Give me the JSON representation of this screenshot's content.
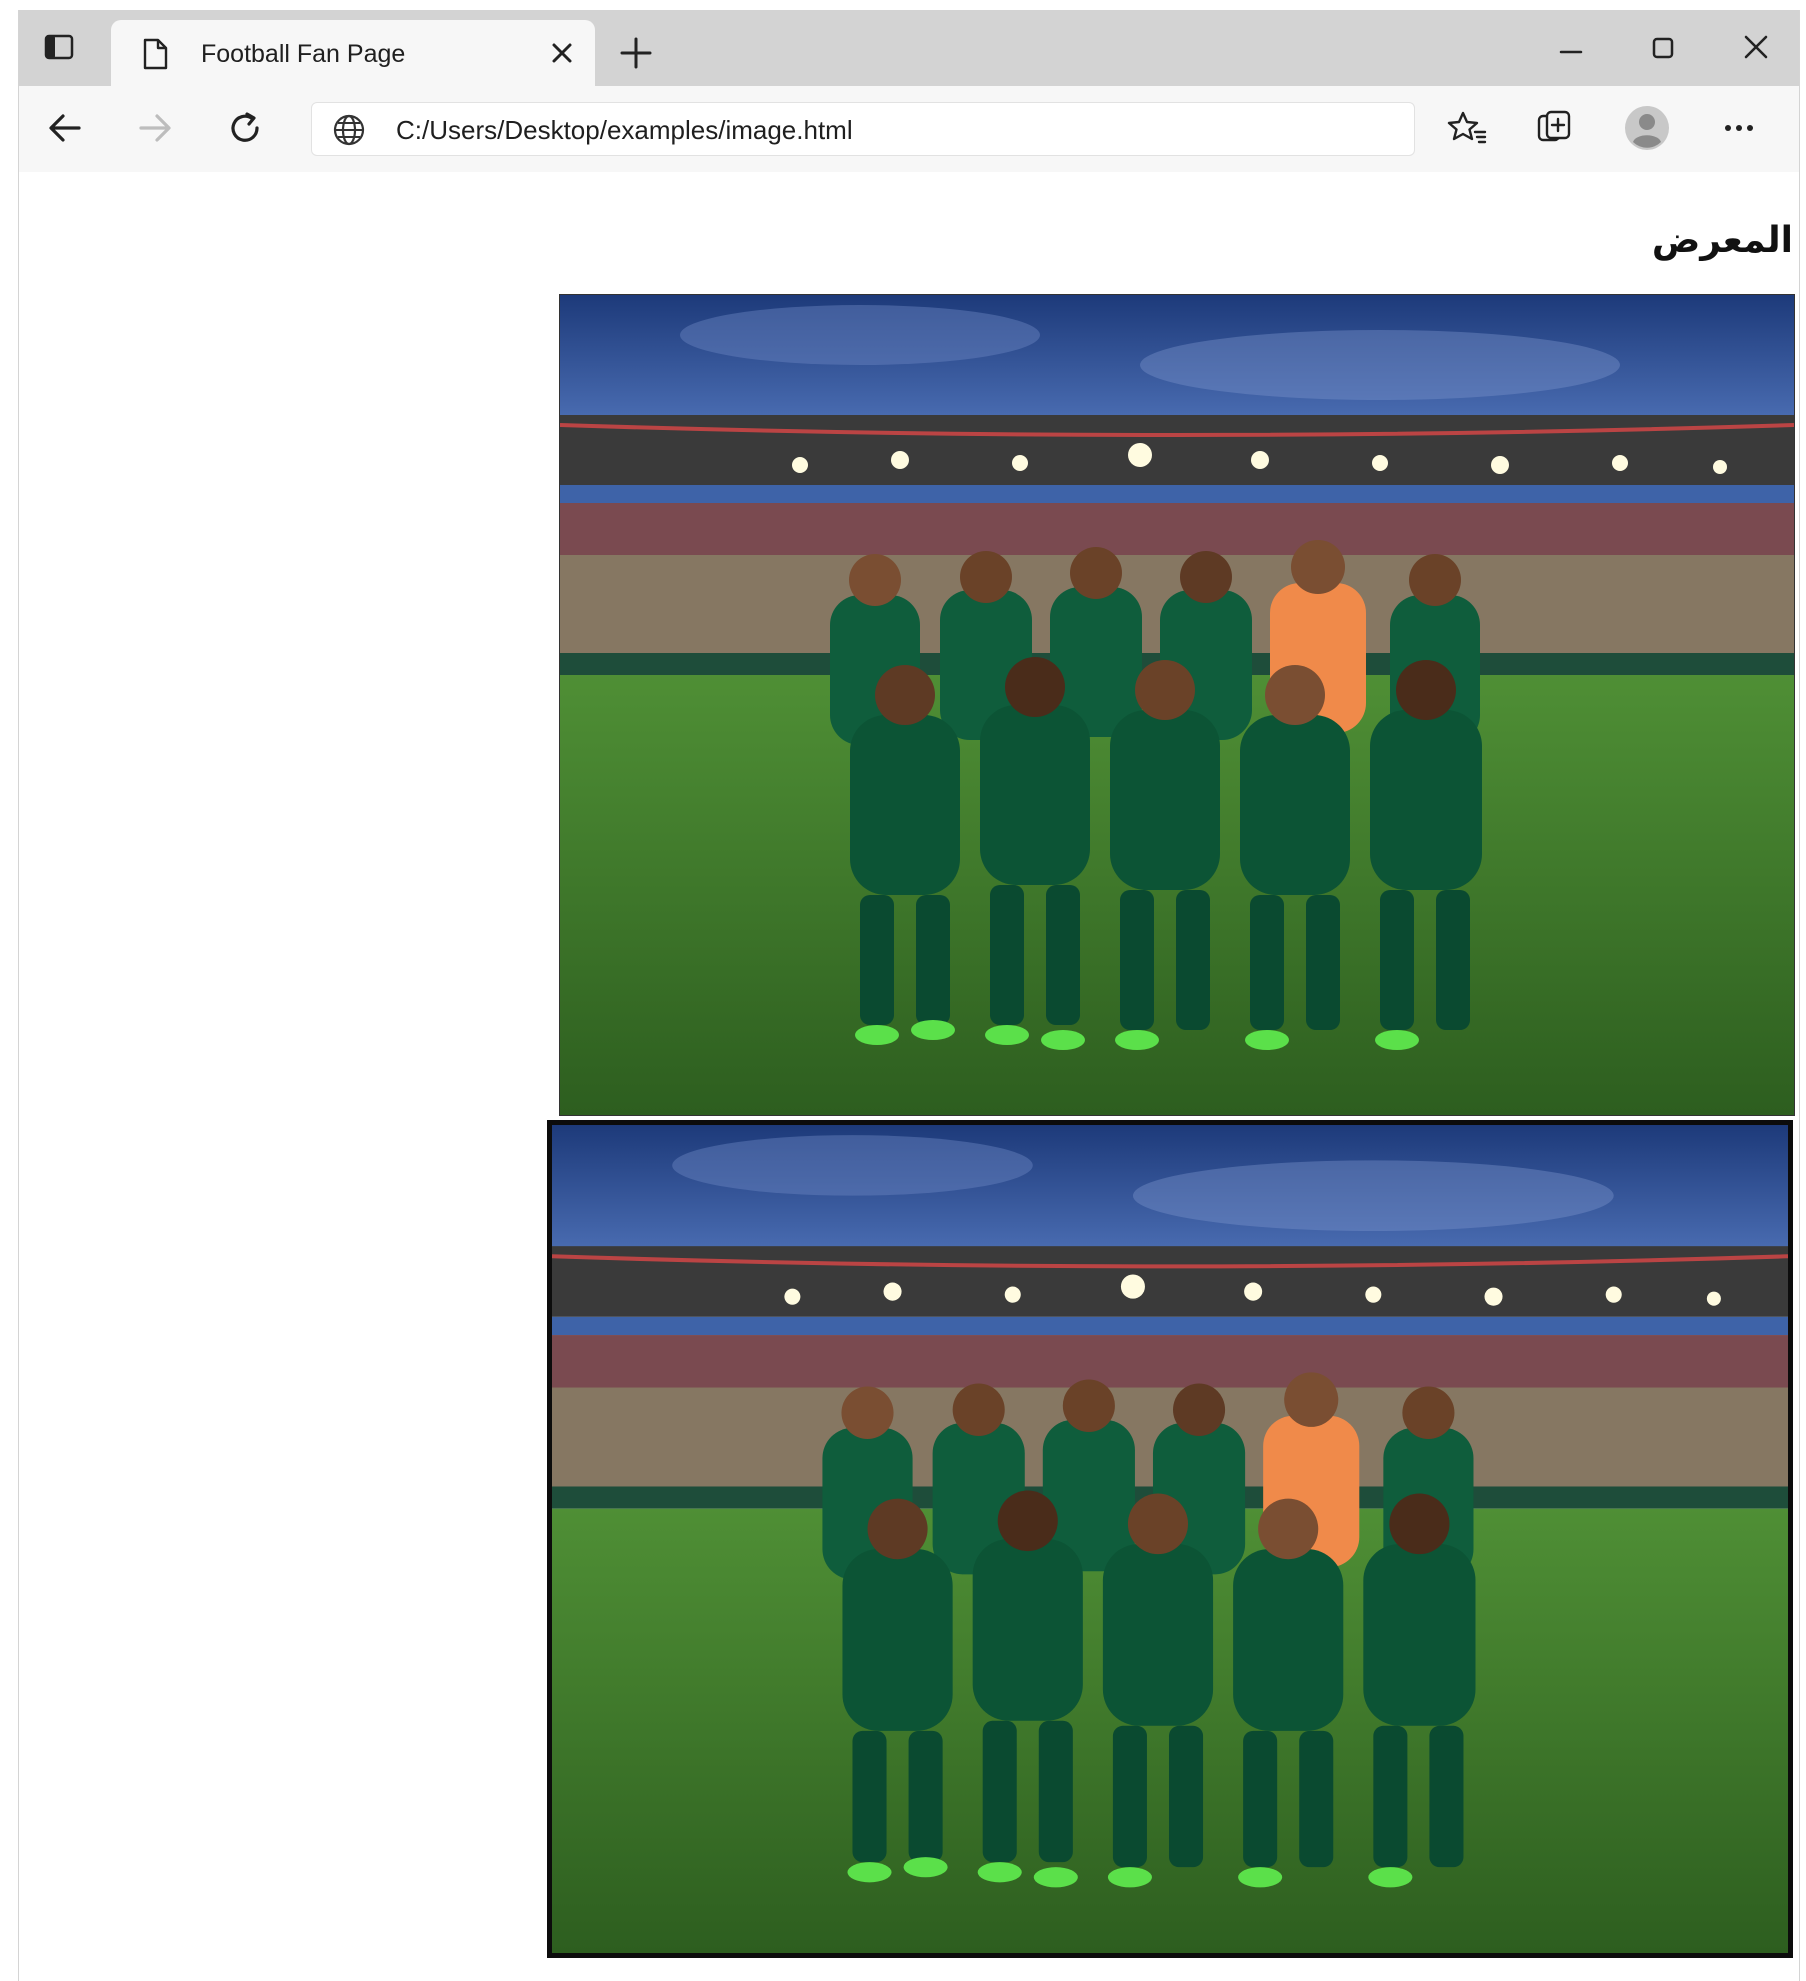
{
  "browser": {
    "tab": {
      "title": "Football Fan Page"
    },
    "address_bar": {
      "url": "C:/Users/Desktop/examples/image.html"
    },
    "icons": {
      "tab_actions": "tab-actions-icon",
      "page": "page-icon",
      "close_tab": "close-icon",
      "new_tab": "plus-icon",
      "minimize": "minimize-icon",
      "maximize": "maximize-icon",
      "close_window": "close-icon",
      "back": "back-arrow-icon",
      "forward": "forward-arrow-icon",
      "refresh": "refresh-icon",
      "site_info": "globe-icon",
      "favorites": "favorites-star-icon",
      "collections": "collections-icon",
      "profile": "profile-avatar-icon",
      "more": "more-dots-icon"
    }
  },
  "page": {
    "heading": "المعرض",
    "images": [
      {
        "description": "team-photo",
        "frame": "thin"
      },
      {
        "description": "team-photo",
        "frame": "thick-black"
      }
    ]
  },
  "colors": {
    "tabstrip": "#d3d3d3",
    "toolbar": "#f7f7f7",
    "jersey_green": "#0f5d3c",
    "goalkeeper_orange": "#f08a4a",
    "pitch_green": "#3f7a2a",
    "sky_blue": "#2f4f93"
  }
}
